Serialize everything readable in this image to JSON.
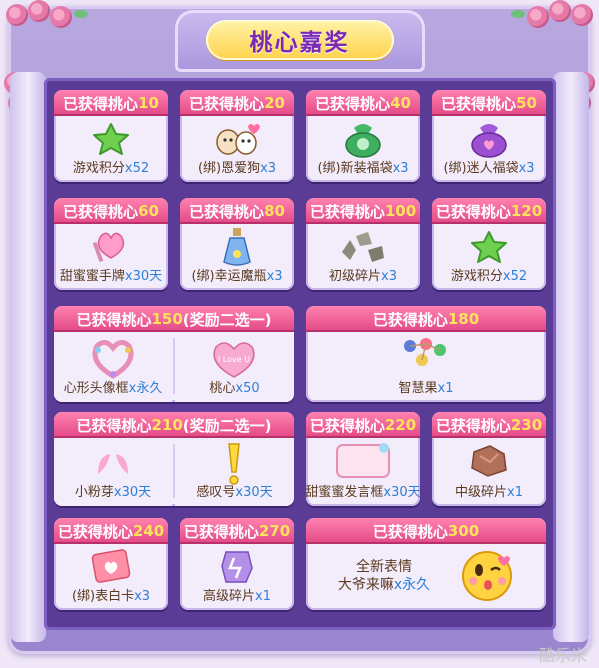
{
  "title": "桃心嘉奖",
  "prefix": "已获得桃心",
  "rewards": [
    {
      "need": "10",
      "item": "游戏积分",
      "qty": "x52"
    },
    {
      "need": "20",
      "item": "(绑)恩爱狗",
      "qty": "x3"
    },
    {
      "need": "40",
      "item": "(绑)新装福袋",
      "qty": "x3"
    },
    {
      "need": "50",
      "item": "(绑)迷人福袋",
      "qty": "x3"
    },
    {
      "need": "60",
      "item": "甜蜜蜜手牌",
      "qty": "x30天"
    },
    {
      "need": "80",
      "item": "(绑)幸运魔瓶",
      "qty": "x3"
    },
    {
      "need": "100",
      "item": "初级碎片",
      "qty": "x3"
    },
    {
      "need": "120",
      "item": "游戏积分",
      "qty": "x52"
    },
    {
      "need": "150",
      "note": "(奖励二选一)",
      "a_item": "心形头像框",
      "a_qty": "x永久",
      "b_item": "桃心",
      "b_qty": "x50"
    },
    {
      "need": "180",
      "item": "智慧果",
      "qty": "x1"
    },
    {
      "need": "210",
      "note": "(奖励二选一)",
      "a_item": "小粉芽",
      "a_qty": "x30天",
      "b_item": "感叹号",
      "b_qty": "x30天"
    },
    {
      "need": "220",
      "item": "甜蜜蜜发言框",
      "qty": "x30天"
    },
    {
      "need": "230",
      "item": "中级碎片",
      "qty": "x1"
    },
    {
      "need": "240",
      "item": "(绑)表白卡",
      "qty": "x3"
    },
    {
      "need": "270",
      "item": "高级碎片",
      "qty": "x1"
    },
    {
      "need": "300",
      "item_line1": "全新表情",
      "item_line2": "大爷来嘛",
      "qty": "x永久"
    }
  ],
  "heart_text": "I Love U",
  "watermark": "酷乐米"
}
